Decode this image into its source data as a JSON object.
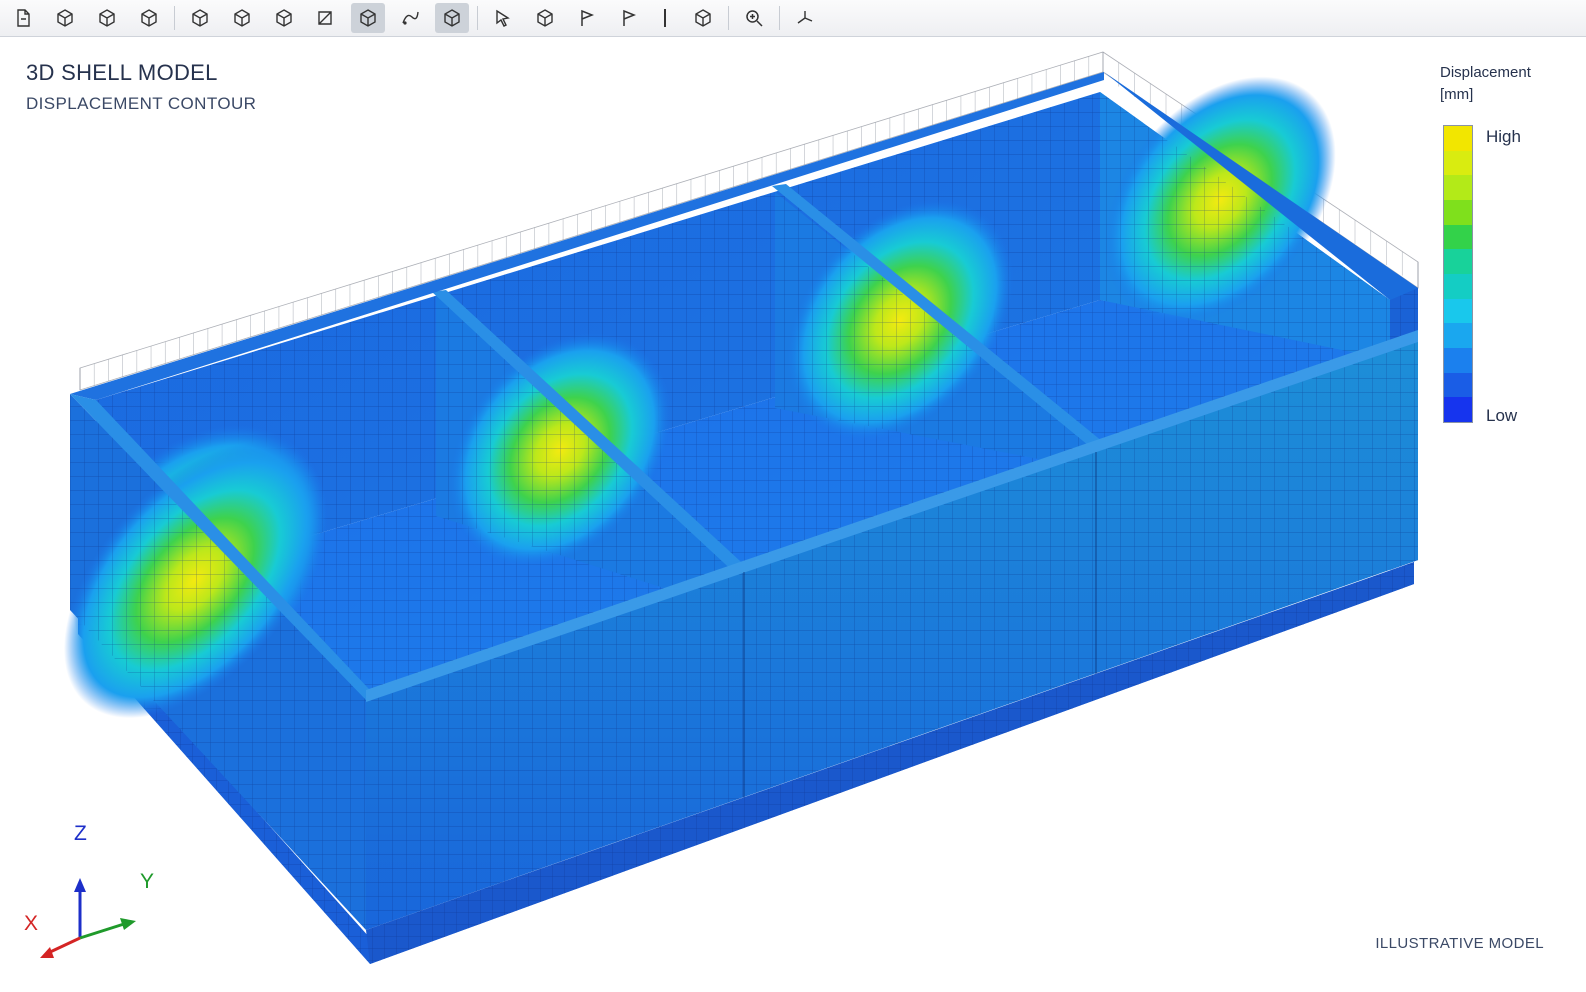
{
  "toolbar": {
    "buttons": [
      {
        "icon": "new-file-icon"
      },
      {
        "icon": "cube-view-iso-icon"
      },
      {
        "icon": "cube-view-front-icon"
      },
      {
        "icon": "cube-view-side-icon"
      },
      {
        "icon": "cube-shaded-icon"
      },
      {
        "icon": "cube-shaded-alt-icon"
      },
      {
        "icon": "cube-wire-icon"
      },
      {
        "icon": "section-view-icon"
      },
      {
        "icon": "cube-active-icon",
        "active": true
      },
      {
        "icon": "deformed-shape-icon"
      },
      {
        "icon": "cube-active-2-icon",
        "active": true
      },
      {
        "icon": "select-pointer-icon"
      },
      {
        "icon": "cube-settings-icon"
      },
      {
        "icon": "flag-icon"
      },
      {
        "icon": "flag-outline-icon"
      },
      {
        "icon": "cube-outline-icon"
      },
      {
        "icon": "zoom-icon"
      },
      {
        "icon": "axes-orient-icon"
      }
    ]
  },
  "view": {
    "title": "3D SHELL MODEL",
    "subtitle": "DISPLACEMENT CONTOUR",
    "footnote": "ILLUSTRATIVE MODEL"
  },
  "legend": {
    "title_line1": "Displacement",
    "title_line2": "[mm]",
    "high_label": "High",
    "low_label": "Low",
    "colors": [
      "#f2e600",
      "#d9ec10",
      "#b3ea18",
      "#7fe01c",
      "#33d24a",
      "#18d29a",
      "#14cdc4",
      "#19c8ec",
      "#1aa7ef",
      "#1b80ee",
      "#1a5de6",
      "#1634ee"
    ]
  },
  "axes": {
    "z_label": "Z",
    "y_label": "Y",
    "x_label": "X",
    "z_color": "#1d2fc9",
    "y_color": "#1f9a2b",
    "x_color": "#d42424"
  }
}
